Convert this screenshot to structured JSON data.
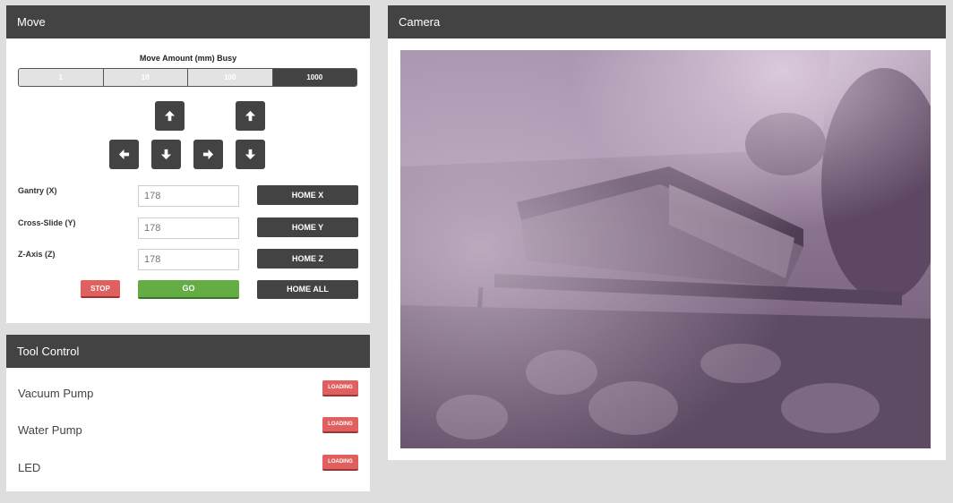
{
  "move": {
    "title": "Move",
    "amount_title": "Move Amount (mm) Busy",
    "amounts": [
      "1",
      "10",
      "100",
      "1000"
    ],
    "selected_amount": "1000",
    "axes": [
      {
        "label": "Gantry (X)",
        "value": "178",
        "home_label": "HOME X"
      },
      {
        "label": "Cross-Slide (Y)",
        "value": "178",
        "home_label": "HOME Y"
      },
      {
        "label": "Z-Axis (Z)",
        "value": "178",
        "home_label": "HOME Z"
      }
    ],
    "stop_label": "STOP",
    "go_label": "GO",
    "home_all_label": "HOME ALL"
  },
  "tool_control": {
    "title": "Tool Control",
    "tools": [
      {
        "label": "Vacuum Pump",
        "status": "LOADING"
      },
      {
        "label": "Water Pump",
        "status": "LOADING"
      },
      {
        "label": "LED",
        "status": "LOADING"
      }
    ]
  },
  "camera": {
    "title": "Camera"
  },
  "colors": {
    "header": "#434343",
    "go": "#64ad45",
    "stop": "#e06060",
    "background": "#dedede"
  },
  "icons": [
    "arrow-up-icon",
    "arrow-down-icon",
    "arrow-left-icon",
    "arrow-right-icon"
  ]
}
